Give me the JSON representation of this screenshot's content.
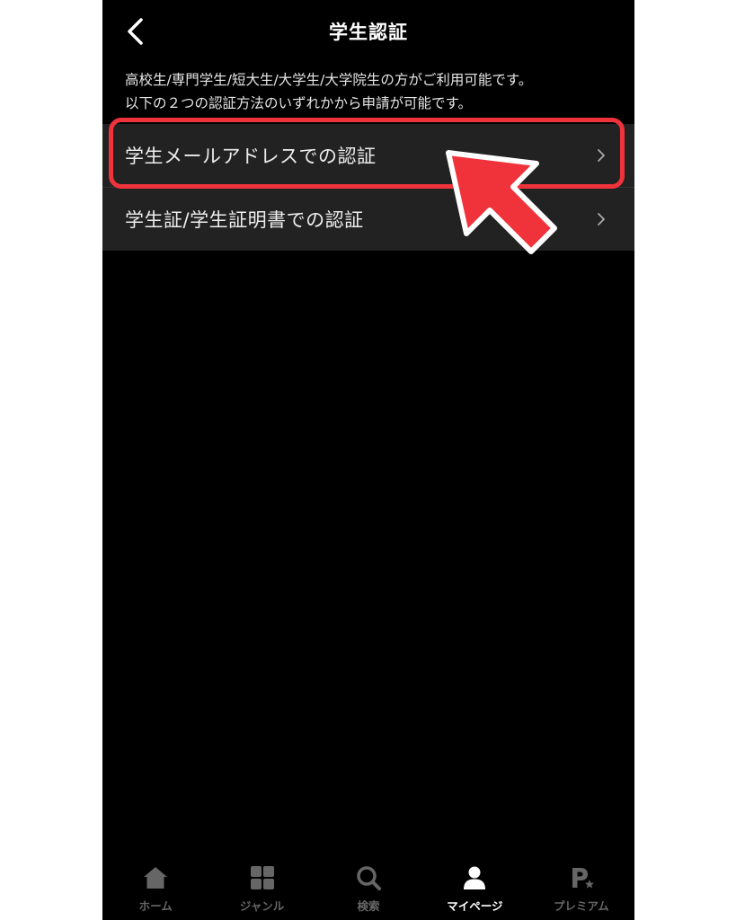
{
  "header": {
    "title": "学生認証"
  },
  "description": {
    "line1": "高校生/専門学生/短大生/大学生/大学院生の方がご利用可能です。",
    "line2": "以下の２つの認証方法のいずれかから申請が可能です。"
  },
  "menu": {
    "items": [
      {
        "label": "学生メールアドレスでの認証"
      },
      {
        "label": "学生証/学生証明書での認証"
      }
    ]
  },
  "annotation": {
    "highlight_color": "#f0333b"
  },
  "tabbar": {
    "items": [
      {
        "label": "ホーム",
        "icon": "home-icon"
      },
      {
        "label": "ジャンル",
        "icon": "grid-icon"
      },
      {
        "label": "検索",
        "icon": "search-icon"
      },
      {
        "label": "マイページ",
        "icon": "person-icon",
        "active": true
      },
      {
        "label": "プレミアム",
        "icon": "premium-p-star-icon"
      }
    ]
  },
  "colors": {
    "background": "#000000",
    "row_background": "#222222",
    "inactive_tab": "#666666",
    "active_tab": "#ffffff"
  }
}
